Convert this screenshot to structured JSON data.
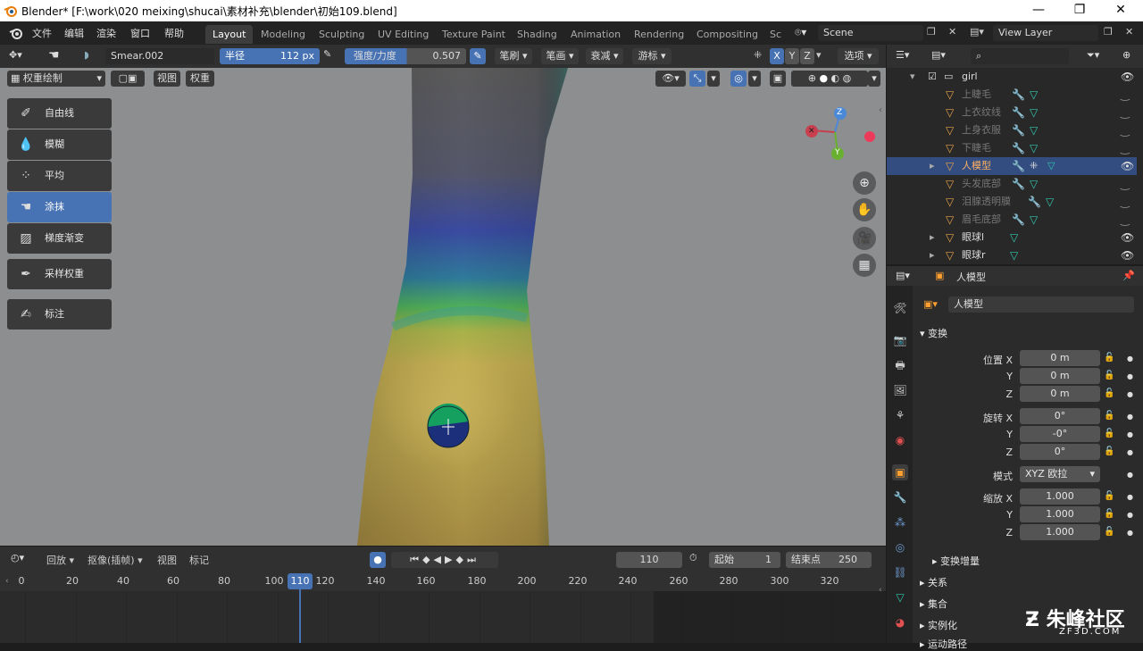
{
  "titlebar": {
    "title": "Blender* [F:\\work\\020 meixing\\shucai\\素材补充\\blender\\初始109.blend]"
  },
  "menu": [
    "文件",
    "编辑",
    "渲染",
    "窗口",
    "帮助"
  ],
  "workspaces": [
    "Layout",
    "Modeling",
    "Sculpting",
    "UV Editing",
    "Texture Paint",
    "Shading",
    "Animation",
    "Rendering",
    "Compositing",
    "Sc"
  ],
  "scene": "Scene",
  "view_layer": "View Layer",
  "tool_header": {
    "brush_name": "Smear.002",
    "radius_label": "半径",
    "radius_value": "112 px",
    "strength_label": "强度/力度",
    "strength_value": "0.507",
    "dropdowns": [
      "笔刷",
      "笔画",
      "衰减",
      "游标"
    ],
    "axes": [
      "X",
      "Y",
      "Z"
    ],
    "options": "选项"
  },
  "viewport_header": {
    "mode": "权重绘制",
    "menus": [
      "视图",
      "权重"
    ]
  },
  "tools": [
    "自由线",
    "模糊",
    "平均",
    "涂抹",
    "梯度渐变",
    "采样权重",
    "标注"
  ],
  "gizmo": {
    "z": "Z",
    "y": "Y"
  },
  "outliner": {
    "search_placeholder": "",
    "root": "girl",
    "items": [
      "上睫毛",
      "上衣纹线",
      "上身衣服",
      "下睫毛",
      "人模型",
      "头发底部",
      "泪腺透明膜",
      "眉毛底部",
      "眼球l",
      "眼球r"
    ]
  },
  "properties": {
    "header_object": "人模型",
    "object_name": "人模型",
    "transform_section": "变换",
    "location_label": "位置 X",
    "location": [
      "0 m",
      "0 m",
      "0 m"
    ],
    "rotation_label": "旋转 X",
    "rotation": [
      "0°",
      "-0°",
      "0°"
    ],
    "mode_label": "模式",
    "mode_value": "XYZ 欧拉",
    "scale_label": "缩放 X",
    "scale": [
      "1.000",
      "1.000",
      "1.000"
    ],
    "axis_y": "Y",
    "axis_z": "Z",
    "delta_transform": "变换增量",
    "relations": "关系",
    "collections": "集合",
    "instancing": "实例化",
    "motion_paths": "运动路径"
  },
  "timeline": {
    "playback": "回放",
    "keying": "抠像(插帧)",
    "view": "视图",
    "marker": "标记",
    "current_frame": "110",
    "start_label": "起始",
    "start_value": "1",
    "end_label": "结束点",
    "end_value": "250",
    "ticks": [
      "0",
      "20",
      "40",
      "60",
      "80",
      "100",
      "120",
      "140",
      "160",
      "180",
      "200",
      "220",
      "240",
      "260",
      "280",
      "300",
      "320"
    ]
  },
  "watermark": {
    "text": "朱峰社区",
    "url": "ZF3D.COM"
  }
}
